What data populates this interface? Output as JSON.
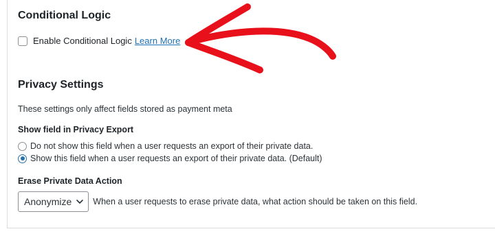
{
  "conditional_logic": {
    "title": "Conditional Logic",
    "checkbox_label": "Enable Conditional Logic",
    "link_text": "Learn More",
    "checked": false
  },
  "privacy": {
    "title": "Privacy Settings",
    "description": "These settings only affect fields stored as payment meta",
    "export": {
      "label": "Show field in Privacy Export",
      "options": [
        {
          "label": "Do not show this field when a user requests an export of their private data.",
          "checked": false
        },
        {
          "label": "Show this field when a user requests an export of their private data. (Default)",
          "checked": true
        }
      ]
    },
    "erase": {
      "label": "Erase Private Data Action",
      "selected": "Anonymize",
      "help": "When a user requests to erase private data, what action should be taken on this field."
    }
  },
  "colors": {
    "link": "#2271b1",
    "annotation_arrow": "#e8101a"
  }
}
